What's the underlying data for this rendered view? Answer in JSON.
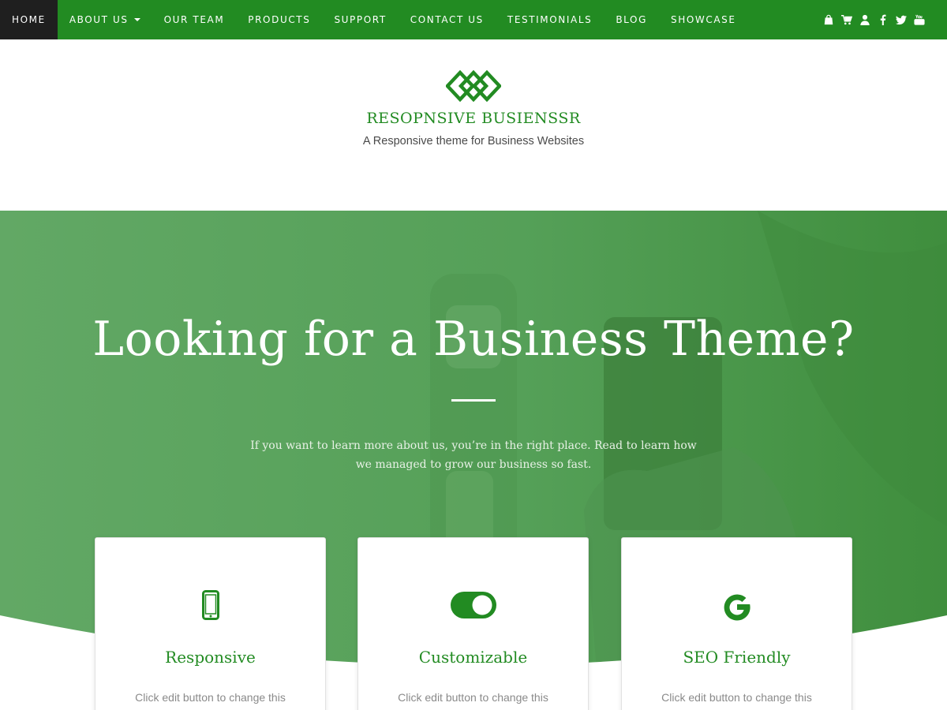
{
  "nav": {
    "items": [
      {
        "label": "Home",
        "active": true
      },
      {
        "label": "About Us",
        "dropdown": true
      },
      {
        "label": "Our Team"
      },
      {
        "label": "Products"
      },
      {
        "label": "Support"
      },
      {
        "label": "Contact Us"
      },
      {
        "label": "Testimonials"
      },
      {
        "label": "Blog"
      },
      {
        "label": "Showcase"
      }
    ],
    "icons": [
      "shopping-bag-icon",
      "cart-icon",
      "user-icon",
      "facebook-icon",
      "twitter-icon",
      "youtube-icon"
    ]
  },
  "brand": {
    "title": "RESOPNSIVE BUSIENSSR",
    "tagline": "A Responsive theme for Business Websites"
  },
  "hero": {
    "title": "Looking for a Business Theme?",
    "text": "If you want to learn more about us, you’re in the right place. Read to learn how we managed to grow our business so fast."
  },
  "features": [
    {
      "icon": "mobile-phone-icon",
      "title": "Responsive",
      "text": "Click edit button to change this"
    },
    {
      "icon": "toggle-on-icon",
      "title": "Customizable",
      "text": "Click edit button to change this"
    },
    {
      "icon": "google-g-icon",
      "title": "SEO Friendly",
      "text": "Click edit button to change this"
    }
  ],
  "colors": {
    "brand_green": "#228b22",
    "nav_active_bg": "#1f1f1f",
    "hero_overlay": "#5aa25e"
  }
}
